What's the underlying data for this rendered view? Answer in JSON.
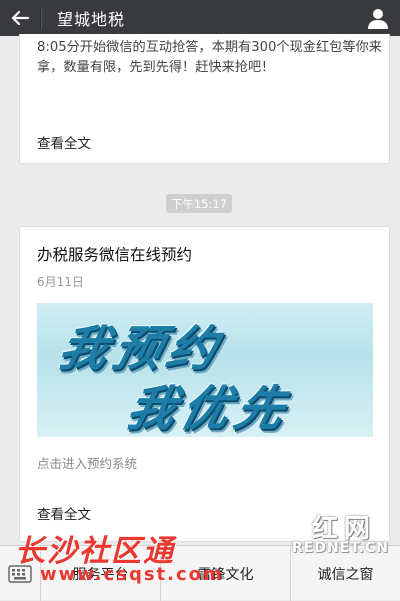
{
  "header": {
    "title": "望城地税",
    "back_icon": "arrow-left-icon",
    "profile_icon": "person-icon"
  },
  "card1": {
    "text": "8:05分开始微信的互动抢答，本期有300个现金红包等你来拿，数量有限，先到先得！赶快来抢吧！",
    "read_more": "查看全文"
  },
  "timestamp": "下午15:17",
  "card2": {
    "title": "办税服务微信在线预约",
    "date": "6月11日",
    "banner_line1": "我预约",
    "banner_line2": "我优先",
    "desc": "点击进入预约系统",
    "read_more": "查看全文"
  },
  "bottom_menu": {
    "keyboard_icon": "keyboard-icon",
    "items": [
      "服务平台",
      "雷锋文化",
      "诚信之窗"
    ]
  },
  "watermarks": {
    "w1": "长沙社区通",
    "w2": "www.csqst.com",
    "w3": "REDNET.CN",
    "w3_hanzi": "红网"
  },
  "colors": {
    "topbar": "#393a3e",
    "background": "#ebebeb",
    "watermark_red": "#e8382f"
  }
}
